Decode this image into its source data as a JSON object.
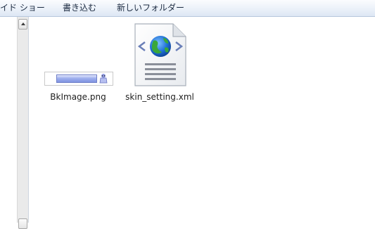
{
  "toolbar": {
    "items": [
      {
        "label": "イド ショー"
      },
      {
        "label": "書き込む"
      },
      {
        "label": "新しいフォルダー"
      }
    ]
  },
  "files": [
    {
      "name": "BkImage.png",
      "type": "png",
      "icon": "image-thumbnail-icon"
    },
    {
      "name": "skin_setting.xml",
      "type": "xml",
      "icon": "xml-file-icon"
    }
  ],
  "colors": {
    "toolbar_top": "#fbfcfe",
    "toolbar_bottom": "#dde7f4",
    "globe_blue": "#1f6fd6",
    "globe_green": "#3aa83a"
  }
}
